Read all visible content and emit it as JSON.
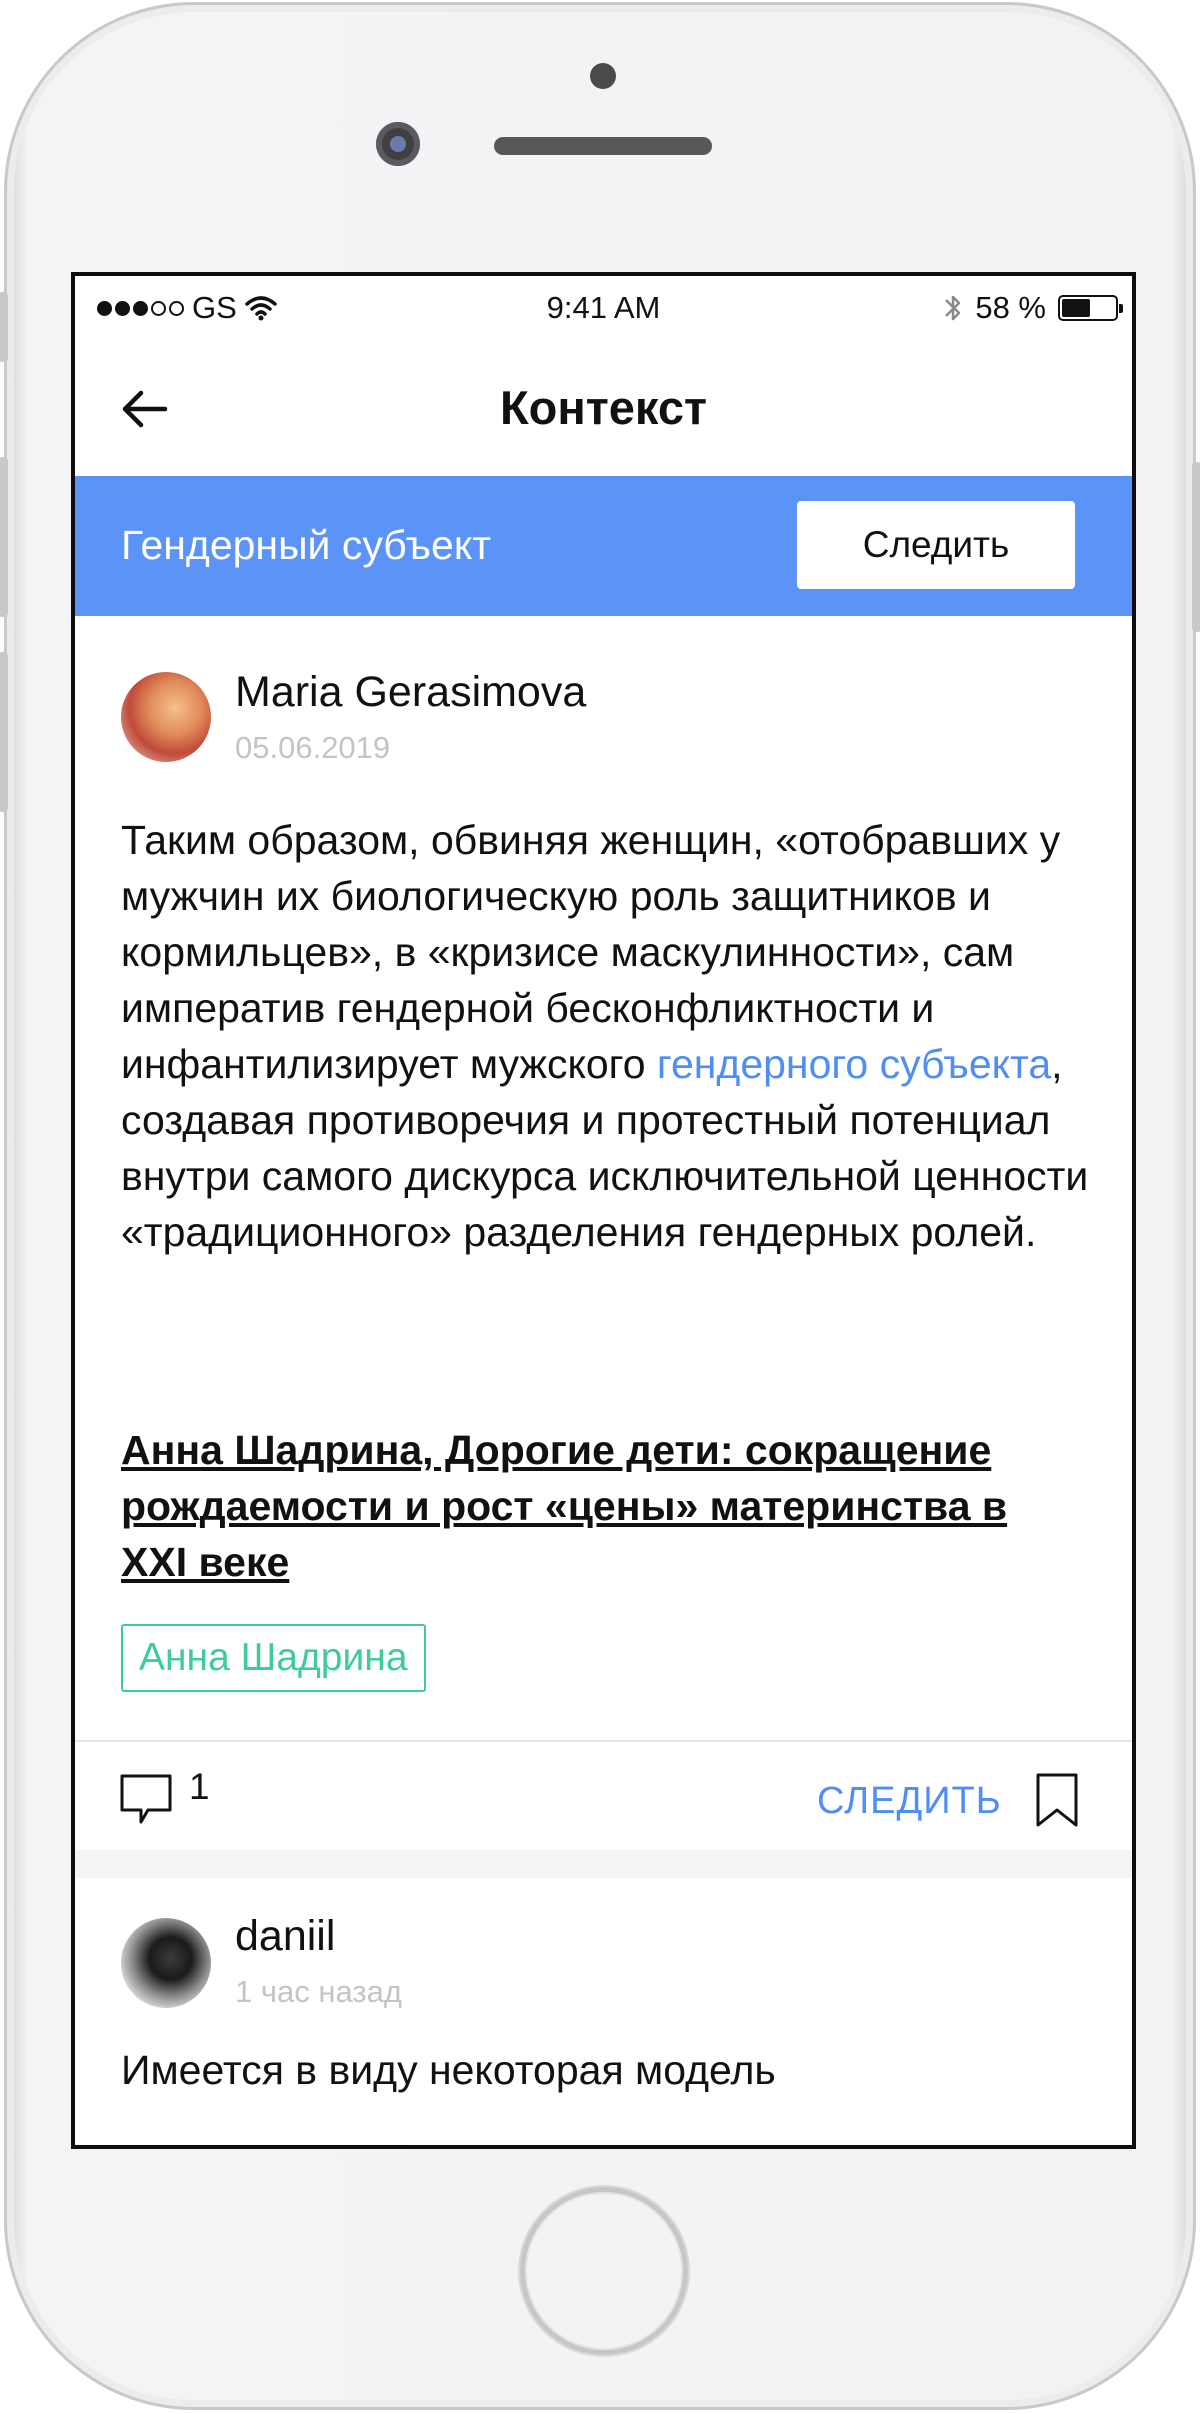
{
  "status_bar": {
    "carrier": "GS",
    "time": "9:41 AM",
    "battery_percent_text": "58 %",
    "battery_level": 0.58,
    "signal_dots_filled": 3,
    "signal_dots_total": 5,
    "icons": [
      "wifi-icon",
      "bluetooth-icon",
      "battery-icon"
    ]
  },
  "nav": {
    "title": "Контекст",
    "back_icon": "arrow-left-icon"
  },
  "topic": {
    "name": "Гендерный субъект",
    "follow_label": "Следить",
    "color": "#5b93f6"
  },
  "posts": [
    {
      "author": "Maria Gerasimova",
      "date": "05.06.2019",
      "text_before": "Таким образом, обвиняя женщин, «отобравших у мужчин их биологическую роль защитников и кормильцев», в «кризисе маскулинности», сам императив гендерной бесконфликтности и инфантилизирует мужского ",
      "text_link": "гендерного субъекта",
      "text_after": ", создавая противоречия и протестный потенциал внутри самого дискурса исключительной ценности «традиционного» разделения гендерных ролей.",
      "source": "Анна Шадрина, Дорогие дети: сокращение рождаемости и рост «цены» материнства в XXI веке",
      "tag": "Анна Шадрина",
      "comment_count": "1",
      "follow_label": "СЛЕДИТЬ"
    },
    {
      "author": "daniil",
      "date": "1 час назад",
      "text": "Имеется в виду некоторая модель"
    }
  ],
  "colors": {
    "accent_blue": "#4f8ef4",
    "tag_green": "#3fcaa0"
  }
}
